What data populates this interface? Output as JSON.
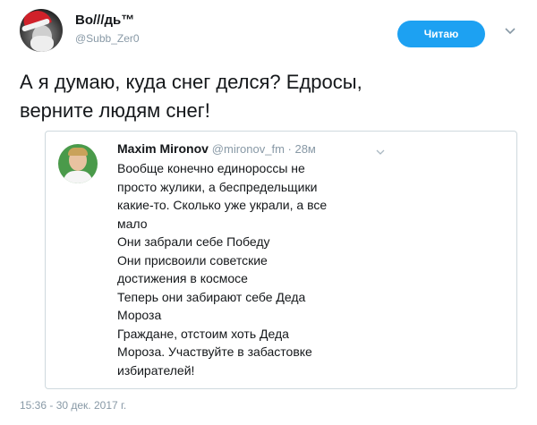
{
  "author": {
    "display_name": "Во///дь™",
    "handle": "@Subb_Zer0",
    "avatar_icon": "santa-hat-avatar"
  },
  "follow_button": {
    "label": "Читаю",
    "color": "#1da1f2"
  },
  "menu_icon": "chevron-down-icon",
  "tweet": {
    "text_lines": [
      "А я думаю, куда снег делся? Едросы,",
      "верните людям снег!"
    ]
  },
  "quoted": {
    "name": "Maxim Mironov",
    "handle": "@mironov_fm",
    "separator": " · ",
    "age": "28м",
    "lines": [
      "Вообще конечно единороссы не",
      "просто жулики, а беспредельщики",
      "какие-то. Сколько уже украли, а все",
      "мало",
      "Они забрали себе Победу",
      "Они присвоили советские",
      "достижения в космосе",
      "Теперь они забирают себе Деда",
      "Мороза",
      "Граждане, отстоим хоть Деда",
      "Мороза. Участвуйте в забастовке",
      "избирателей!"
    ]
  },
  "timestamp": "15:36 - 30 дек. 2017 г."
}
